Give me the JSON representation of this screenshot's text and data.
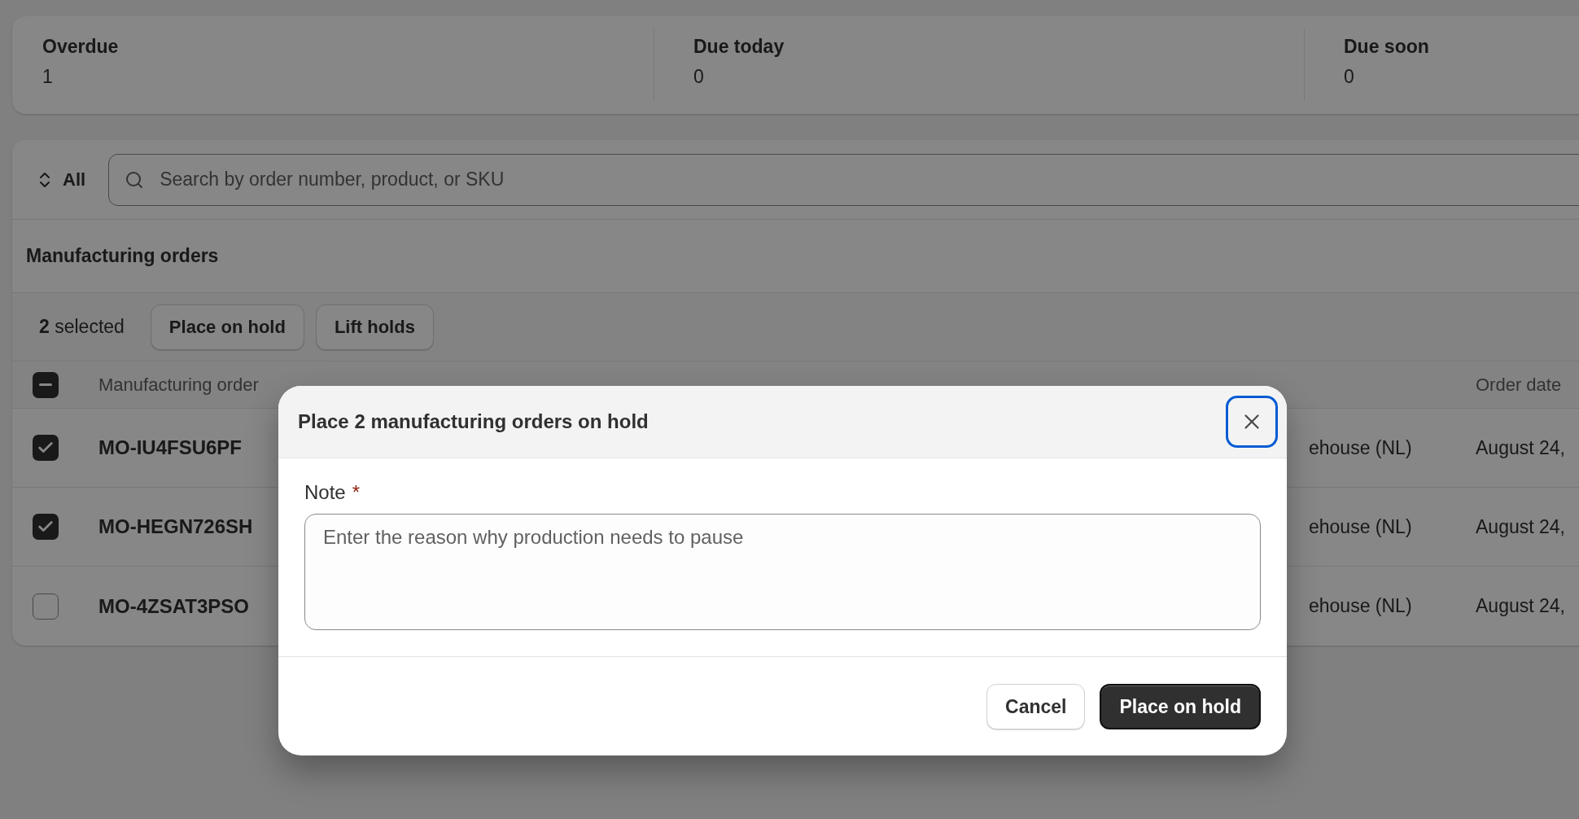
{
  "stats": [
    {
      "label": "Overdue",
      "value": "1"
    },
    {
      "label": "Due today",
      "value": "0"
    },
    {
      "label": "Due soon",
      "value": "0"
    }
  ],
  "filter": {
    "label": "All"
  },
  "search": {
    "placeholder": "Search by order number, product, or SKU"
  },
  "section_title": "Manufacturing orders",
  "bulk": {
    "summary": "**2** selected",
    "actions": [
      "Place on hold",
      "Lift holds"
    ]
  },
  "table": {
    "select_all_mixed": true,
    "columns": [
      "Manufacturing order",
      "Order date"
    ],
    "rows": [
      {
        "selected": true,
        "order": "MO-IU4FSU6PF",
        "location": "ehouse (NL)",
        "order_date": "August 24,"
      },
      {
        "selected": true,
        "order": "MO-HEGN726SH",
        "location": "ehouse (NL)",
        "order_date": "August 24,"
      },
      {
        "selected": false,
        "order": "MO-4ZSAT3PSO",
        "location": "ehouse (NL)",
        "order_date": "August 24,"
      }
    ]
  },
  "modal": {
    "title": "Place 2 manufacturing orders on hold",
    "close_focused": true,
    "field": {
      "label": "Note",
      "required_mark": "*",
      "placeholder": "Enter the reason why production needs to pause"
    },
    "buttons": [
      {
        "label": "Cancel",
        "kind": "secondary"
      },
      {
        "label": "Place on hold",
        "kind": "primary"
      }
    ]
  }
}
